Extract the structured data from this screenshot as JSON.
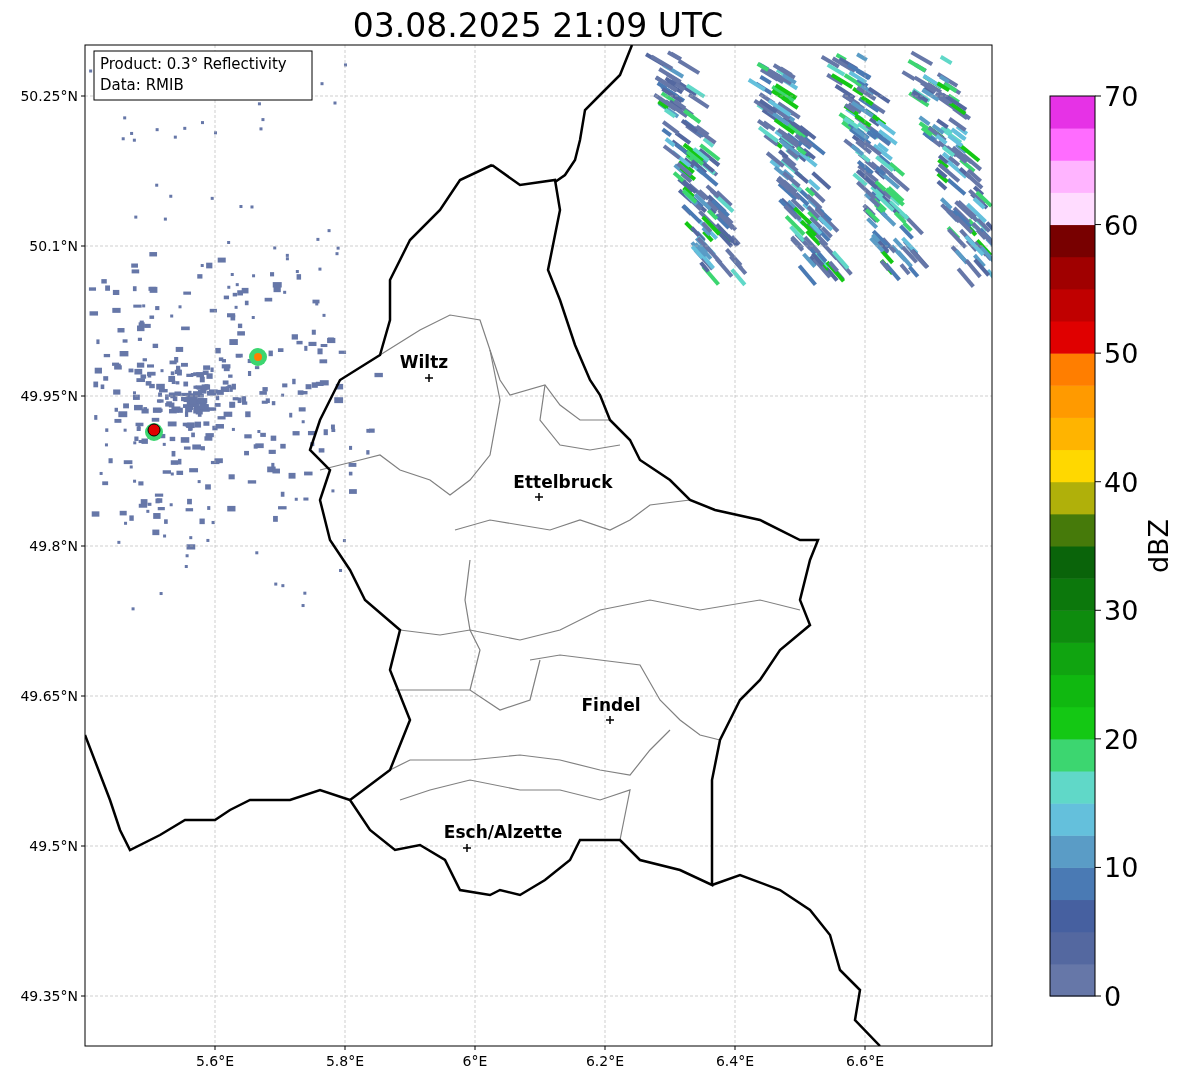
{
  "title": "03.08.2025 21:09 UTC",
  "info_box": {
    "lines": [
      "Product: 0.3° Reflectivity",
      "Data: RMIB"
    ]
  },
  "map": {
    "y_ticks": [
      "50.25°N",
      "50.1°N",
      "49.95°N",
      "49.8°N",
      "49.65°N",
      "49.5°N",
      "49.35°N"
    ],
    "x_ticks": [
      "5.6°E",
      "5.8°E",
      "6°E",
      "6.2°E",
      "6.4°E",
      "6.6°E"
    ],
    "places": [
      {
        "name": "Wiltz"
      },
      {
        "name": "Ettelbruck"
      },
      {
        "name": "Findel"
      },
      {
        "name": "Esch/Alzette"
      }
    ]
  },
  "colorbar": {
    "label": "dBZ",
    "ticks": [
      "70",
      "60",
      "50",
      "40",
      "30",
      "20",
      "10",
      "0"
    ],
    "bands": [
      {
        "color": "#6677a8"
      },
      {
        "color": "#5468a0"
      },
      {
        "color": "#4660a0"
      },
      {
        "color": "#4a7ab4"
      },
      {
        "color": "#5a9cc6"
      },
      {
        "color": "#64c0dc"
      },
      {
        "color": "#60d8c8"
      },
      {
        "color": "#3cd670"
      },
      {
        "color": "#14c814"
      },
      {
        "color": "#10b810"
      },
      {
        "color": "#10a410"
      },
      {
        "color": "#0e8c0e"
      },
      {
        "color": "#0c780c"
      },
      {
        "color": "#0a640a"
      },
      {
        "color": "#467a0a"
      },
      {
        "color": "#b0b00a"
      },
      {
        "color": "#ffd800"
      },
      {
        "color": "#ffb400"
      },
      {
        "color": "#ff9a00"
      },
      {
        "color": "#ff7e00"
      },
      {
        "color": "#e00000"
      },
      {
        "color": "#c00000"
      },
      {
        "color": "#a00000"
      },
      {
        "color": "#780000"
      },
      {
        "color": "#ffdcff"
      },
      {
        "color": "#ffb4ff"
      },
      {
        "color": "#ff6cff"
      },
      {
        "color": "#e632e6"
      }
    ]
  }
}
